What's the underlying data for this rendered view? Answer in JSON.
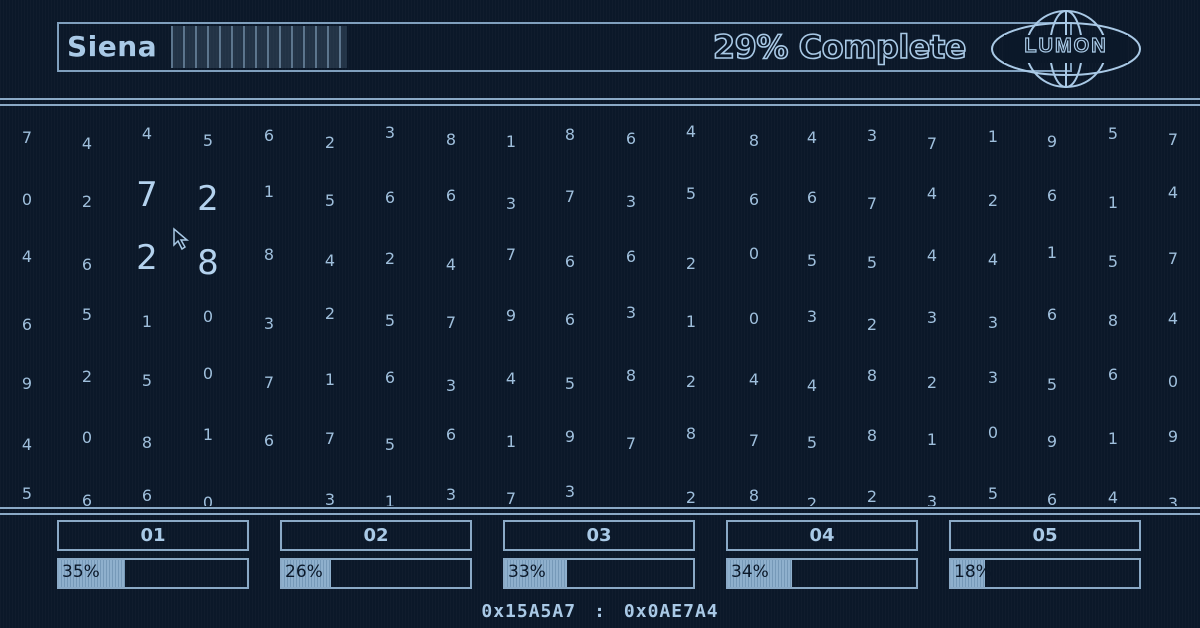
{
  "header": {
    "file_name": "Siena",
    "progress_text": "29% Complete",
    "progress_percent": 29,
    "logo_text": "LUMON"
  },
  "grid": {
    "rows": [
      [
        "7",
        "4",
        "4",
        "5",
        "6",
        "2",
        "3",
        "8",
        "1",
        "8",
        "6",
        "4",
        "8",
        "4",
        "3",
        "7",
        "1",
        "9",
        "5",
        "7"
      ],
      [
        "0",
        "2",
        "7",
        "2",
        "1",
        "5",
        "6",
        "6",
        "3",
        "7",
        "3",
        "5",
        "6",
        "6",
        "7",
        "4",
        "2",
        "6",
        "1",
        "4"
      ],
      [
        "4",
        "6",
        "2",
        "8",
        "8",
        "4",
        "2",
        "4",
        "7",
        "6",
        "6",
        "2",
        "0",
        "5",
        "5",
        "4",
        "4",
        "1",
        "5",
        "7"
      ],
      [
        "6",
        "5",
        "1",
        "0",
        "3",
        "2",
        "5",
        "7",
        "9",
        "6",
        "3",
        "1",
        "0",
        "3",
        "2",
        "3",
        "3",
        "6",
        "8",
        "4"
      ],
      [
        "9",
        "2",
        "5",
        "0",
        "7",
        "1",
        "6",
        "3",
        "4",
        "5",
        "8",
        "2",
        "4",
        "4",
        "8",
        "2",
        "3",
        "5",
        "6",
        "0"
      ],
      [
        "4",
        "0",
        "8",
        "1",
        "6",
        "7",
        "5",
        "6",
        "1",
        "9",
        "7",
        "8",
        "7",
        "5",
        "8",
        "1",
        "0",
        "9",
        "1",
        "9"
      ],
      [
        "5",
        "6",
        "6",
        "0",
        "",
        "3",
        "1",
        "3",
        "7",
        "3",
        "",
        "2",
        "8",
        "2",
        "2",
        "3",
        "5",
        "6",
        "4",
        "3"
      ]
    ],
    "highlighted": [
      [
        1,
        2
      ],
      [
        1,
        3
      ],
      [
        2,
        2
      ],
      [
        2,
        3
      ]
    ]
  },
  "bins": [
    {
      "label": "01",
      "percent_text": "35%",
      "fill": 0.35
    },
    {
      "label": "02",
      "percent_text": "26%",
      "fill": 0.26
    },
    {
      "label": "03",
      "percent_text": "33%",
      "fill": 0.33
    },
    {
      "label": "04",
      "percent_text": "34%",
      "fill": 0.34
    },
    {
      "label": "05",
      "percent_text": "18%",
      "fill": 0.18
    }
  ],
  "footer": {
    "coord_x": "0x15A5A7",
    "separator": ":",
    "coord_y": "0x0AE7A4"
  },
  "colors": {
    "background": "#0b1829",
    "foreground": "#a9c9e6",
    "line": "#8aa9c6"
  }
}
